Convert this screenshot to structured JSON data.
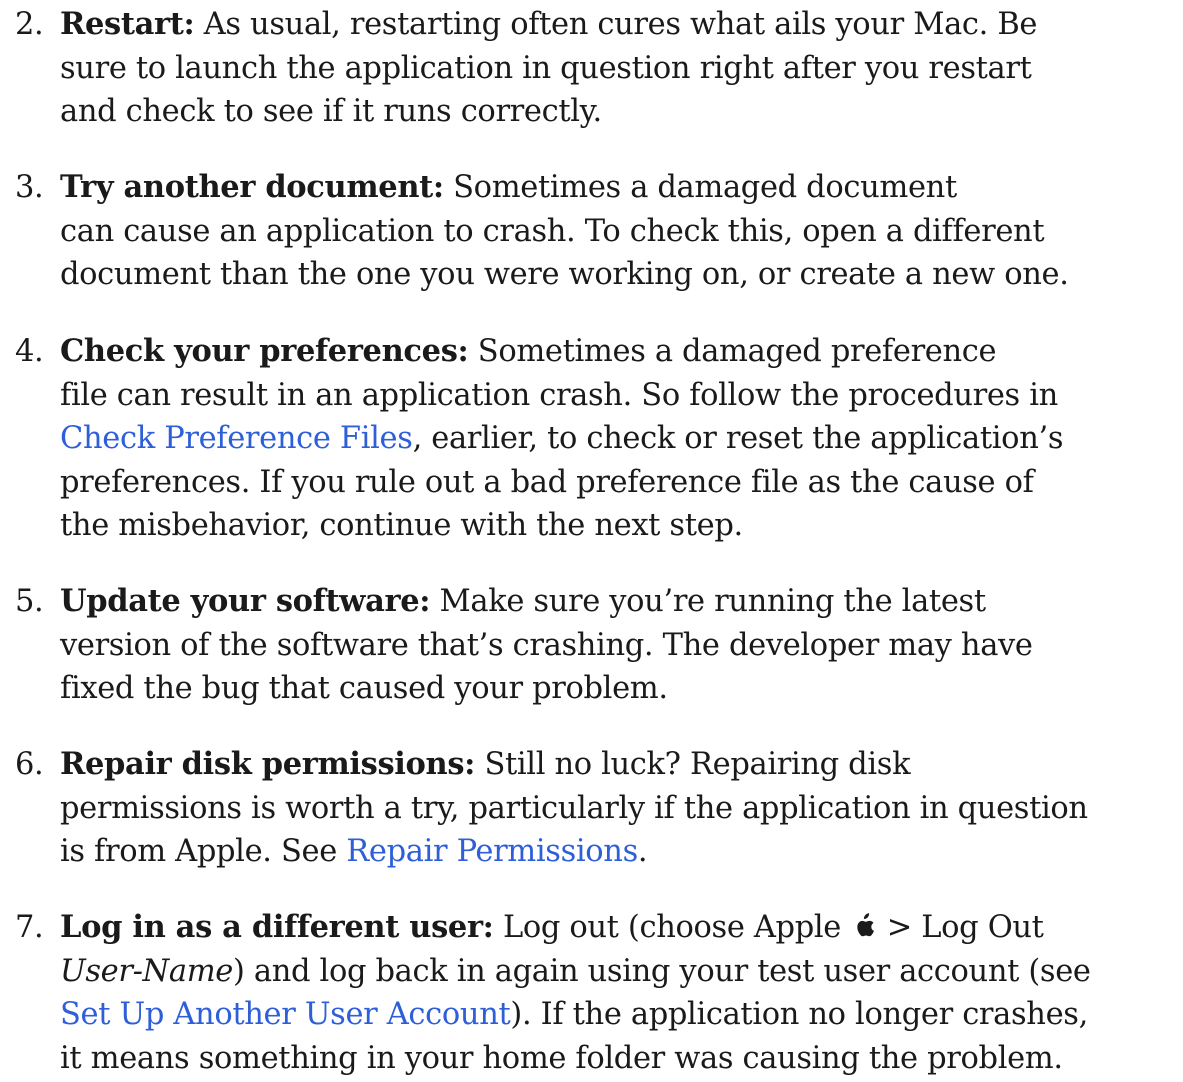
{
  "steps": [
    {
      "number": "2.",
      "title": "Restart:",
      "lines": [
        " As usual, restarting often cures what ails your Mac. Be",
        "sure to launch the application in question right after you restart",
        "and check to see if it runs correctly."
      ]
    },
    {
      "number": "3.",
      "title": "Try another document:",
      "lines": [
        " Sometimes a damaged document",
        "can cause an application to crash. To check this, open a different",
        "document than the one you were working on, or create a new one."
      ]
    },
    {
      "number": "4.",
      "title": "Check your preferences:",
      "lines": [
        " Sometimes a damaged preference",
        "file can result in an application crash. So follow the procedures in"
      ],
      "link": "Check Preference Files",
      "after_link": ", earlier, to check or reset the application’s",
      "tail_lines": [
        "preferences. If you rule out a bad preference file as the cause of",
        "the misbehavior, continue with the next step."
      ]
    },
    {
      "number": "5.",
      "title": "Update your software:",
      "lines": [
        " Make sure you’re running the latest",
        "version of the software that’s crashing. The developer may have",
        "fixed the bug that caused your problem."
      ]
    },
    {
      "number": "6.",
      "title": "Repair disk permissions:",
      "lines": [
        " Still no luck? Repairing disk",
        "permissions is worth a try, particularly if the application in question"
      ],
      "before_link": "is from Apple. See ",
      "link": "Repair Permissions",
      "after_link": "."
    },
    {
      "number": "7.",
      "title": "Log in as a different user:",
      "title_rest": " Log out (choose Apple",
      "title_rest2": " > Log Out",
      "italic": "User-Name",
      "line2_rest": ") and log back in again using your test user account (see",
      "link": "Set Up Another User Account",
      "after_link": "). If the application no longer crashes,",
      "last_line": "it means something in your home folder was causing the problem."
    }
  ]
}
